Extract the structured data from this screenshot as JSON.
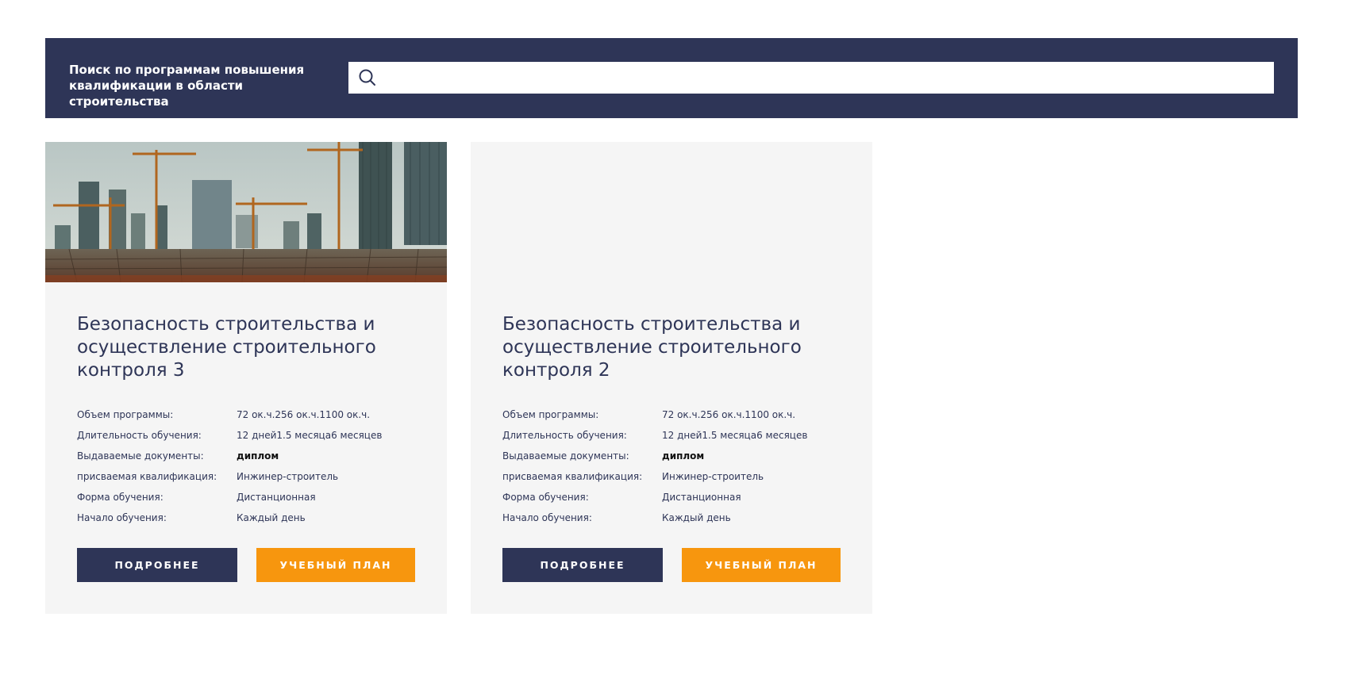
{
  "search": {
    "label": "Поиск по программам повышения\nквалификации в области строительства",
    "placeholder": "",
    "icon": "search-icon"
  },
  "colors": {
    "navy": "#2e3557",
    "orange": "#f7960e",
    "card_bg": "#f5f5f5"
  },
  "cards": [
    {
      "title": "Безопасность строительства и осуществление строительного контроля 3",
      "has_image": true,
      "details": [
        {
          "label": "Объем программы:",
          "value": "72 ок.ч.256 ок.ч.1100 ок.ч."
        },
        {
          "label": "Длительность обучения:",
          "value": "12 дней1.5 месяца6 месяцев"
        },
        {
          "label": "Выдаваемые документы:",
          "value": "диплом"
        },
        {
          "label": "присваемая квалификация:",
          "value": "Инжинер-строитель"
        },
        {
          "label": "Форма обучения:",
          "value": "Дистанционная"
        },
        {
          "label": "Начало обучения:",
          "value": "Каждый день"
        }
      ],
      "more_label": "ПОДРОБНЕЕ",
      "plan_label": "УЧЕБНЫЙ ПЛАН"
    },
    {
      "title": "Безопасность строительства и осуществление строительного контроля 2",
      "has_image": false,
      "details": [
        {
          "label": "Объем программы:",
          "value": "72 ок.ч.256 ок.ч.1100 ок.ч."
        },
        {
          "label": "Длительность обучения:",
          "value": "12 дней1.5 месяца6 месяцев"
        },
        {
          "label": "Выдаваемые документы:",
          "value": "диплом"
        },
        {
          "label": "присваемая квалификация:",
          "value": "Инжинер-строитель"
        },
        {
          "label": "Форма обучения:",
          "value": "Дистанционная"
        },
        {
          "label": "Начало обучения:",
          "value": "Каждый день"
        }
      ],
      "more_label": "ПОДРОБНЕЕ",
      "plan_label": "УЧЕБНЫЙ ПЛАН"
    }
  ]
}
